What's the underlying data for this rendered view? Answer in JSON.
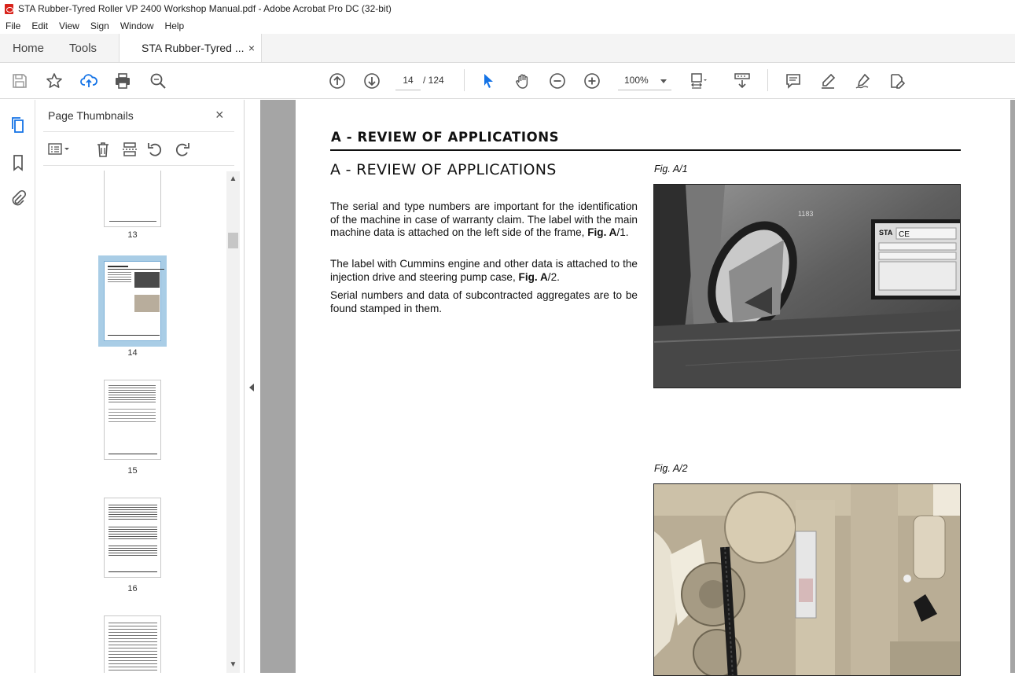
{
  "window": {
    "title": "STA Rubber-Tyred Roller VP 2400 Workshop Manual.pdf - Adobe Acrobat Pro DC (32-bit)"
  },
  "menu": [
    "File",
    "Edit",
    "View",
    "Sign",
    "Window",
    "Help"
  ],
  "tabs": {
    "home": "Home",
    "tools": "Tools",
    "document": "STA Rubber-Tyred ...",
    "close_symbol": "×"
  },
  "toolbar": {
    "page_current": "14",
    "page_total": "/ 124",
    "zoom": "100%"
  },
  "thumbnails": {
    "title": "Page Thumbnails",
    "close_symbol": "×",
    "pages": [
      "13",
      "14",
      "15",
      "16"
    ]
  },
  "document": {
    "header": "A - REVIEW OF APPLICATIONS",
    "section_title": "A -  REVIEW OF APPLICATIONS",
    "paragraphs": [
      {
        "text": "The serial and type numbers are important for the identification of the machine in case of warranty claim. The label with the main machine data is attached on the left side of the frame, ",
        "ref_bold": "Fig. A",
        "ref_rest": "/1",
        "end": "."
      },
      {
        "text": "The label with Cummins engine and other data is attached to the injection drive and steering pump case, ",
        "ref_bold": "Fig. A",
        "ref_rest": "/2",
        "end": "."
      },
      {
        "text": "Serial numbers and data of subcontracted aggregates are to be found stamped in them.",
        "ref_bold": "",
        "ref_rest": "",
        "end": ""
      }
    ],
    "figures": [
      {
        "caption": "Fig. A/1",
        "plate_text": "STA",
        "plate_mark": "CE",
        "stamp": "1183"
      },
      {
        "caption": "Fig. A/2"
      }
    ]
  }
}
